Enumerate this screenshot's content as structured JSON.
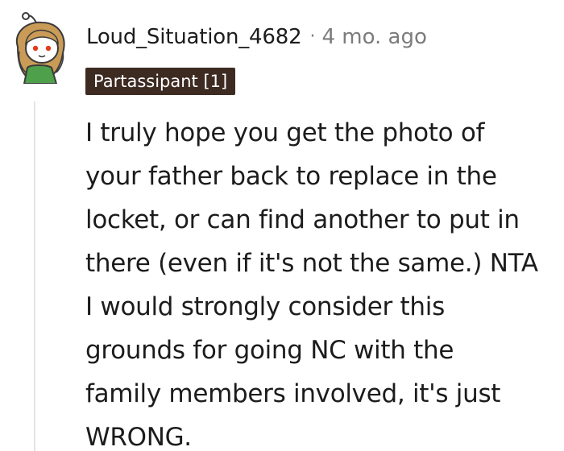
{
  "comment": {
    "author": "Loud_Situation_4682",
    "separator": "·",
    "timestamp": "4 mo. ago",
    "flair": "Partassipant [1]",
    "body": "I truly hope you get the photo of\nyour father back to replace in the\nlocket, or can find another to put in\nthere (even if it's not the same.) NTA\nI would strongly consider this\ngrounds for going NC with the\nfamily members involved, it's just\nWRONG.",
    "avatar_icon": "snoo-avatar-icon"
  }
}
